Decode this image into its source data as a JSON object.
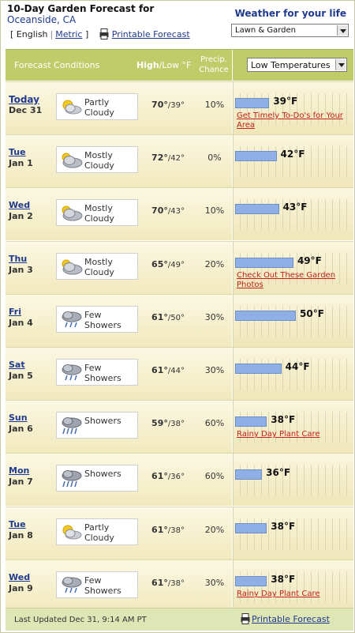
{
  "header": {
    "title": "10-Day Garden Forecast for",
    "location": "Oceanside, CA",
    "english_label": "English",
    "metric_label": "Metric",
    "printable_label": "Printable Forecast",
    "right_title": "Weather for your life",
    "life_select_value": "Lawn & Garden"
  },
  "columns": {
    "conditions": "Forecast Conditions",
    "high": "High",
    "low_unit": "/Low °F",
    "precip": "Precip. Chance",
    "chart_select_value": "Low Temperatures"
  },
  "chart_data": {
    "type": "bar",
    "title": "Low Temperatures",
    "categories": [
      "Dec 31",
      "Jan 1",
      "Jan 2",
      "Jan 3",
      "Jan 4",
      "Jan 5",
      "Jan 6",
      "Jan 7",
      "Jan 8",
      "Jan 9"
    ],
    "values": [
      39,
      42,
      43,
      49,
      50,
      44,
      38,
      36,
      38,
      38
    ],
    "unit": "°F"
  },
  "rows": [
    {
      "day": "Today",
      "date": "Dec 31",
      "cond1": "Partly",
      "cond2": "Cloudy",
      "icon": "partly-cloudy-icon",
      "hi": "70°",
      "lo": "/39°",
      "pct": "10%",
      "low_label": "39°F",
      "tip": "Get Timely To-Do's for Your Area"
    },
    {
      "day": "Tue",
      "date": "Jan 1",
      "cond1": "Mostly",
      "cond2": "Cloudy",
      "icon": "mostly-cloudy-icon",
      "hi": "72°",
      "lo": "/42°",
      "pct": "0%",
      "low_label": "42°F",
      "tip": ""
    },
    {
      "day": "Wed",
      "date": "Jan 2",
      "cond1": "Mostly",
      "cond2": "Cloudy",
      "icon": "mostly-cloudy-icon",
      "hi": "70°",
      "lo": "/43°",
      "pct": "10%",
      "low_label": "43°F",
      "tip": ""
    },
    {
      "day": "Thu",
      "date": "Jan 3",
      "cond1": "Mostly",
      "cond2": "Cloudy",
      "icon": "mostly-cloudy-icon",
      "hi": "65°",
      "lo": "/49°",
      "pct": "20%",
      "low_label": "49°F",
      "tip": "Check Out These Garden Photos"
    },
    {
      "day": "Fri",
      "date": "Jan 4",
      "cond1": "Few",
      "cond2": "Showers",
      "icon": "few-showers-icon",
      "hi": "61°",
      "lo": "/50°",
      "pct": "30%",
      "low_label": "50°F",
      "tip": ""
    },
    {
      "day": "Sat",
      "date": "Jan 5",
      "cond1": "Few",
      "cond2": "Showers",
      "icon": "few-showers-icon",
      "hi": "61°",
      "lo": "/44°",
      "pct": "30%",
      "low_label": "44°F",
      "tip": ""
    },
    {
      "day": "Sun",
      "date": "Jan 6",
      "cond1": "Showers",
      "cond2": "",
      "icon": "showers-icon",
      "hi": "59°",
      "lo": "/38°",
      "pct": "60%",
      "low_label": "38°F",
      "tip": "Rainy Day Plant Care"
    },
    {
      "day": "Mon",
      "date": "Jan 7",
      "cond1": "Showers",
      "cond2": "",
      "icon": "showers-icon",
      "hi": "61°",
      "lo": "/36°",
      "pct": "60%",
      "low_label": "36°F",
      "tip": ""
    },
    {
      "day": "Tue",
      "date": "Jan 8",
      "cond1": "Partly",
      "cond2": "Cloudy",
      "icon": "partly-cloudy-icon",
      "hi": "61°",
      "lo": "/38°",
      "pct": "20%",
      "low_label": "38°F",
      "tip": ""
    },
    {
      "day": "Wed",
      "date": "Jan 9",
      "cond1": "Few",
      "cond2": "Showers",
      "icon": "few-showers-icon",
      "hi": "61°",
      "lo": "/38°",
      "pct": "30%",
      "low_label": "38°F",
      "tip": "Rainy Day Plant Care"
    }
  ],
  "footer": {
    "last_updated": "Last Updated Dec 31, 9:14 AM PT",
    "printable_label": "Printable Forecast"
  },
  "colors": {
    "header_bar": "#c0cc6a",
    "bar_fill": "#8fb0e6",
    "link_blue": "#1f3a8f",
    "tip_red": "#c0221b"
  }
}
